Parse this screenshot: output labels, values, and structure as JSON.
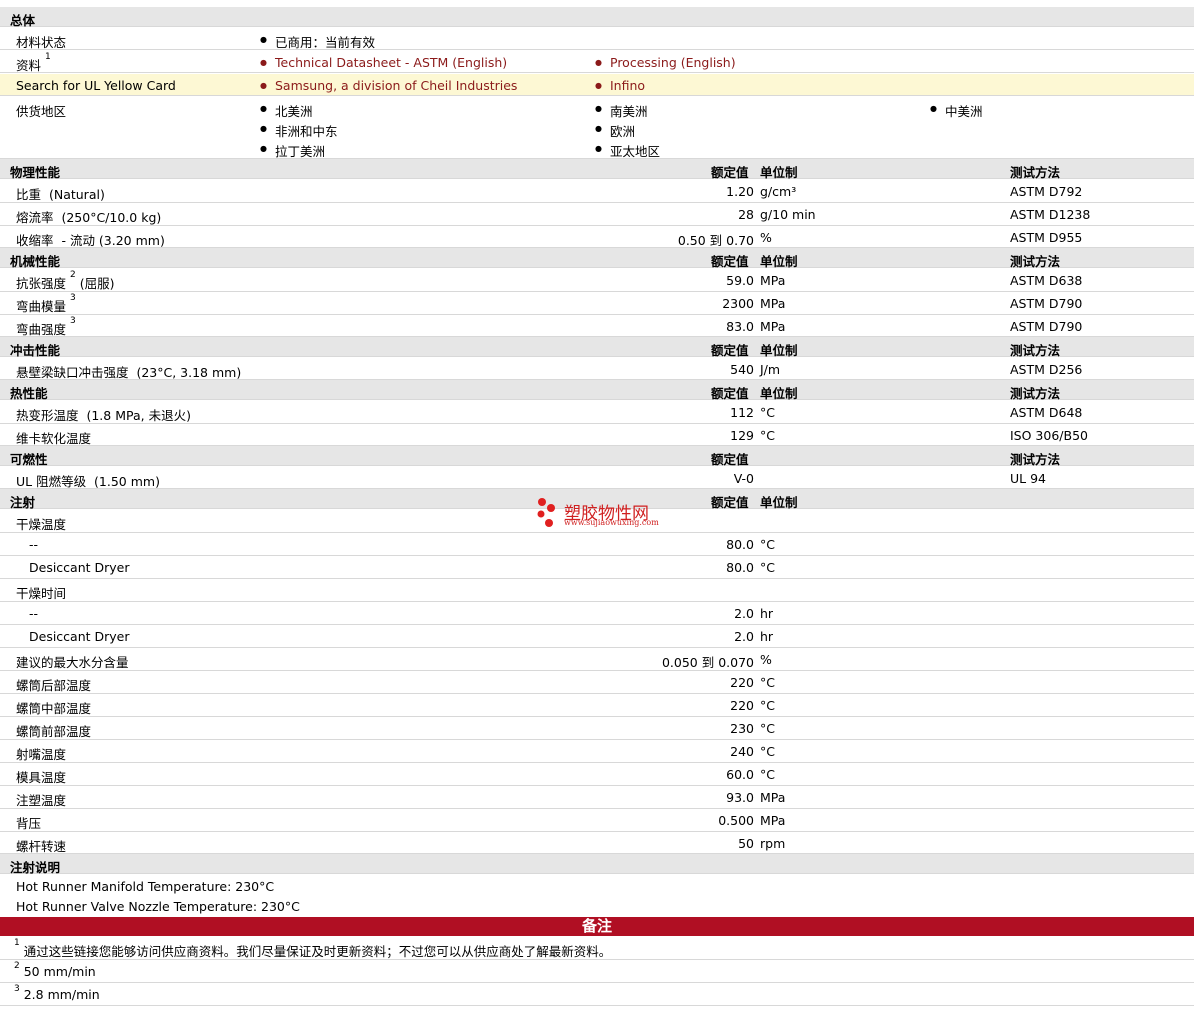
{
  "general": {
    "title": "总体",
    "material_status_label": "材料状态",
    "material_status_value": "已商用：当前有效",
    "docs_label": "资料",
    "docs_sup": "1",
    "docs_link1": "Technical Datasheet - ASTM (English)",
    "docs_link2": "Processing (English)",
    "ul_label": "Search for UL Yellow Card",
    "ul_link1": "Samsung, a division of Cheil Industries",
    "ul_link2": "Infino",
    "supply_label": "供货地区",
    "regions": [
      "北美洲",
      "非洲和中东",
      "拉丁美洲",
      "南美洲",
      "欧洲",
      "亚太地区",
      "中美洲"
    ]
  },
  "headers": {
    "nominal": "额定值",
    "unit": "单位制",
    "method": "测试方法"
  },
  "physical": {
    "title": "物理性能",
    "rows": [
      {
        "name": "比重",
        "cond": "(Natural)",
        "value": "1.20",
        "unit": "g/cm³",
        "method": "ASTM D792"
      },
      {
        "name": "熔流率",
        "cond": "(250°C/10.0 kg)",
        "value": "28",
        "unit": "g/10 min",
        "method": "ASTM D1238"
      },
      {
        "name": "收缩率",
        "cond": "- 流动  (3.20 mm)",
        "value": "0.50 到  0.70",
        "unit": "%",
        "method": "ASTM D955"
      }
    ]
  },
  "mechanical": {
    "title": "机械性能",
    "rows": [
      {
        "name": "抗张强度",
        "sup": "2",
        "cond": "(屈服)",
        "value": "59.0",
        "unit": "MPa",
        "method": "ASTM D638"
      },
      {
        "name": "弯曲模量",
        "sup": "3",
        "cond": "",
        "value": "2300",
        "unit": "MPa",
        "method": "ASTM D790"
      },
      {
        "name": "弯曲强度",
        "sup": "3",
        "cond": "",
        "value": "83.0",
        "unit": "MPa",
        "method": "ASTM D790"
      }
    ]
  },
  "impact": {
    "title": "冲击性能",
    "rows": [
      {
        "name": "悬壁梁缺口冲击强度",
        "cond": "(23°C, 3.18 mm)",
        "value": "540",
        "unit": "J/m",
        "method": "ASTM D256"
      }
    ]
  },
  "thermal": {
    "title": "热性能",
    "rows": [
      {
        "name": "热变形温度",
        "cond": "(1.8 MPa, 未退火)",
        "value": "112",
        "unit": "°C",
        "method": "ASTM D648"
      },
      {
        "name": "维卡软化温度",
        "cond": "",
        "value": "129",
        "unit": "°C",
        "method": "ISO 306/B50"
      }
    ]
  },
  "flammability": {
    "title": "可燃性",
    "rows": [
      {
        "name": "UL 阻燃等级",
        "cond": "(1.50 mm)",
        "value": "V-0",
        "unit": "",
        "method": "UL 94"
      }
    ]
  },
  "injection": {
    "title": "注射",
    "drying_temp": "干燥温度",
    "drying_temp_rows": [
      {
        "name": "--",
        "value": "80.0",
        "unit": "°C"
      },
      {
        "name": "Desiccant Dryer",
        "value": "80.0",
        "unit": "°C"
      }
    ],
    "drying_time": "干燥时间",
    "drying_time_rows": [
      {
        "name": "--",
        "value": "2.0",
        "unit": "hr"
      },
      {
        "name": "Desiccant Dryer",
        "value": "2.0",
        "unit": "hr"
      }
    ],
    "rows": [
      {
        "name": "建议的最大水分含量",
        "value": "0.050 到  0.070",
        "unit": "%"
      },
      {
        "name": "螺筒后部温度",
        "value": "220",
        "unit": "°C"
      },
      {
        "name": "螺筒中部温度",
        "value": "220",
        "unit": "°C"
      },
      {
        "name": "螺筒前部温度",
        "value": "230",
        "unit": "°C"
      },
      {
        "name": "射嘴温度",
        "value": "240",
        "unit": "°C"
      },
      {
        "name": "模具温度",
        "value": "60.0",
        "unit": "°C"
      },
      {
        "name": "注塑温度",
        "value": "93.0",
        "unit": "MPa"
      },
      {
        "name": "背压",
        "value": "0.500",
        "unit": "MPa"
      },
      {
        "name": "螺杆转速",
        "value": "50",
        "unit": "rpm"
      }
    ]
  },
  "injection_notes": {
    "title": "注射说明",
    "lines": [
      "Hot Runner Manifold Temperature: 230°C",
      "Hot Runner Valve Nozzle Temperature: 230°C"
    ]
  },
  "notes": {
    "title": "备注",
    "items": [
      {
        "sup": "1",
        "text": "通过这些链接您能够访问供应商资料。我们尽量保证及时更新资料；不过您可以从供应商处了解最新资料。"
      },
      {
        "sup": "2",
        "text": "50 mm/min"
      },
      {
        "sup": "3",
        "text": "2.8 mm/min"
      }
    ]
  },
  "watermark": {
    "name": "塑胶物性网",
    "url": "www.sujiaowuxing.com"
  },
  "colors": {
    "section_bg": "#e6e6e6",
    "notes_bar": "#b00f23",
    "link": "#8b1a1a",
    "highlight": "#fdf8d4"
  }
}
